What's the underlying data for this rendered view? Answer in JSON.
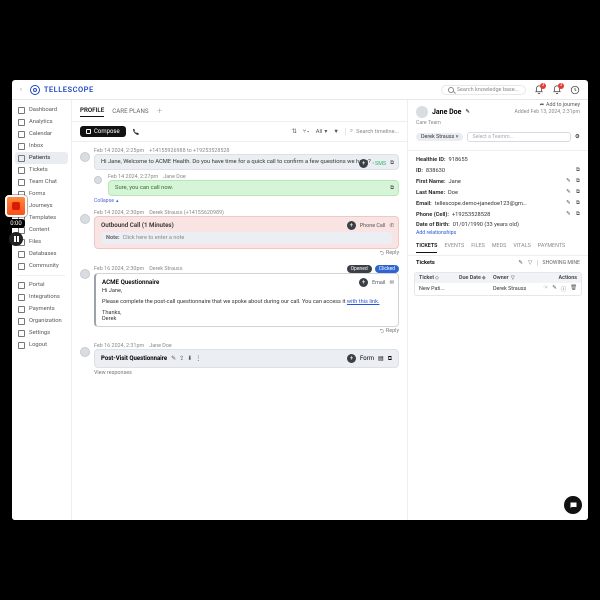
{
  "brand": "TELLESCOPE",
  "recorder": {
    "time": "0:00"
  },
  "topbar": {
    "search_placeholder": "Search knowledge base...",
    "notif1": "3",
    "notif2": "3"
  },
  "sidebar": {
    "items": [
      "Dashboard",
      "Analytics",
      "Calendar",
      "Inbox",
      "Patients",
      "Tickets",
      "Team Chat",
      "Forms",
      "Journeys",
      "Templates",
      "Content",
      "Files",
      "Databases",
      "Community"
    ],
    "items2": [
      "Portal",
      "Integrations",
      "Payments",
      "Organization",
      "Settings",
      "Logout"
    ],
    "selected": "Patients"
  },
  "tabs": {
    "profile": "PROFILE",
    "care": "CARE PLANS"
  },
  "toolbar": {
    "compose": "Compose",
    "filter_all": "All",
    "search_placeholder": "Search timeline..."
  },
  "journey_add": "Add to journey",
  "timeline": {
    "e0": {
      "ts": "Feb 14 2024, 2:25pm",
      "meta": "+14155926988 to +19253528528",
      "text": "Hi Jane, Welcome to ACME Health. Do you have time for a quick call to confirm a few questions we have?",
      "status": "SMS",
      "child_ts": "Feb 14 2024, 2:27pm",
      "child_author": "Jane Doe",
      "child_text": "Sure, you can call now.",
      "collapse": "Collapse"
    },
    "e1": {
      "ts": "Feb 14 2024, 2:30pm",
      "author": "Derek Strauss (+14155620989)",
      "title": "Outbound Call (1 Minutes)",
      "note_label": "Note:",
      "note_ph": "Click here to enter a note",
      "tag": "Phone Call",
      "reply": "Reply"
    },
    "e2": {
      "ts": "Feb 16 2024, 2:30pm",
      "author": "Derek Strauss",
      "pill1": "Opened",
      "pill2": "Clicked",
      "title": "ACME Questionnaire",
      "greeting": "Hi Jane,",
      "body": "Please complete the post-call questionnaire that we spoke about during our call. You can access it ",
      "link": "with this link.",
      "sign1": "Thanks,",
      "sign2": "Derek",
      "tag": "Email",
      "reply": "Reply"
    },
    "e3": {
      "ts": "Feb 16 2024, 2:31pm",
      "author": "Jane Doe",
      "title": "Post-Visit Questionnaire",
      "tag": "Form",
      "view": "View responses"
    }
  },
  "patient": {
    "name": "Jane Doe",
    "added": "Added Feb 13, 2024, 2:31pm",
    "careteam_label": "Care Team",
    "careteam_chip": "Derek Strauss",
    "careteam_ph": "Select a Teamm...",
    "hid_label": "Healthie ID:",
    "hid": "918655",
    "id_label": "ID:",
    "id": "838630",
    "fn_label": "First Name:",
    "fn": "Jane",
    "ln_label": "Last Name:",
    "ln": "Doe",
    "email_label": "Email:",
    "email": "tellescope.demo+janedoe123@gmail.com",
    "phone_label": "Phone (Cell):",
    "phone": "+19253528528",
    "dob_label": "Date of Birth:",
    "dob": "01/01/1990 (33 years old)",
    "rel_add": "Add relationships",
    "tabs": [
      "TICKETS",
      "EVENTS",
      "FILES",
      "MEDS",
      "VITALS",
      "PAYMENTS"
    ],
    "tickets_label": "Tickets",
    "showing_mine": "SHOWING MINE"
  },
  "tickets": {
    "h1": "Ticket",
    "h2": "Due Date",
    "h3": "Owner",
    "h4": "Actions",
    "row": {
      "title": "New Pati...",
      "owner": "Derek Strauss"
    }
  }
}
